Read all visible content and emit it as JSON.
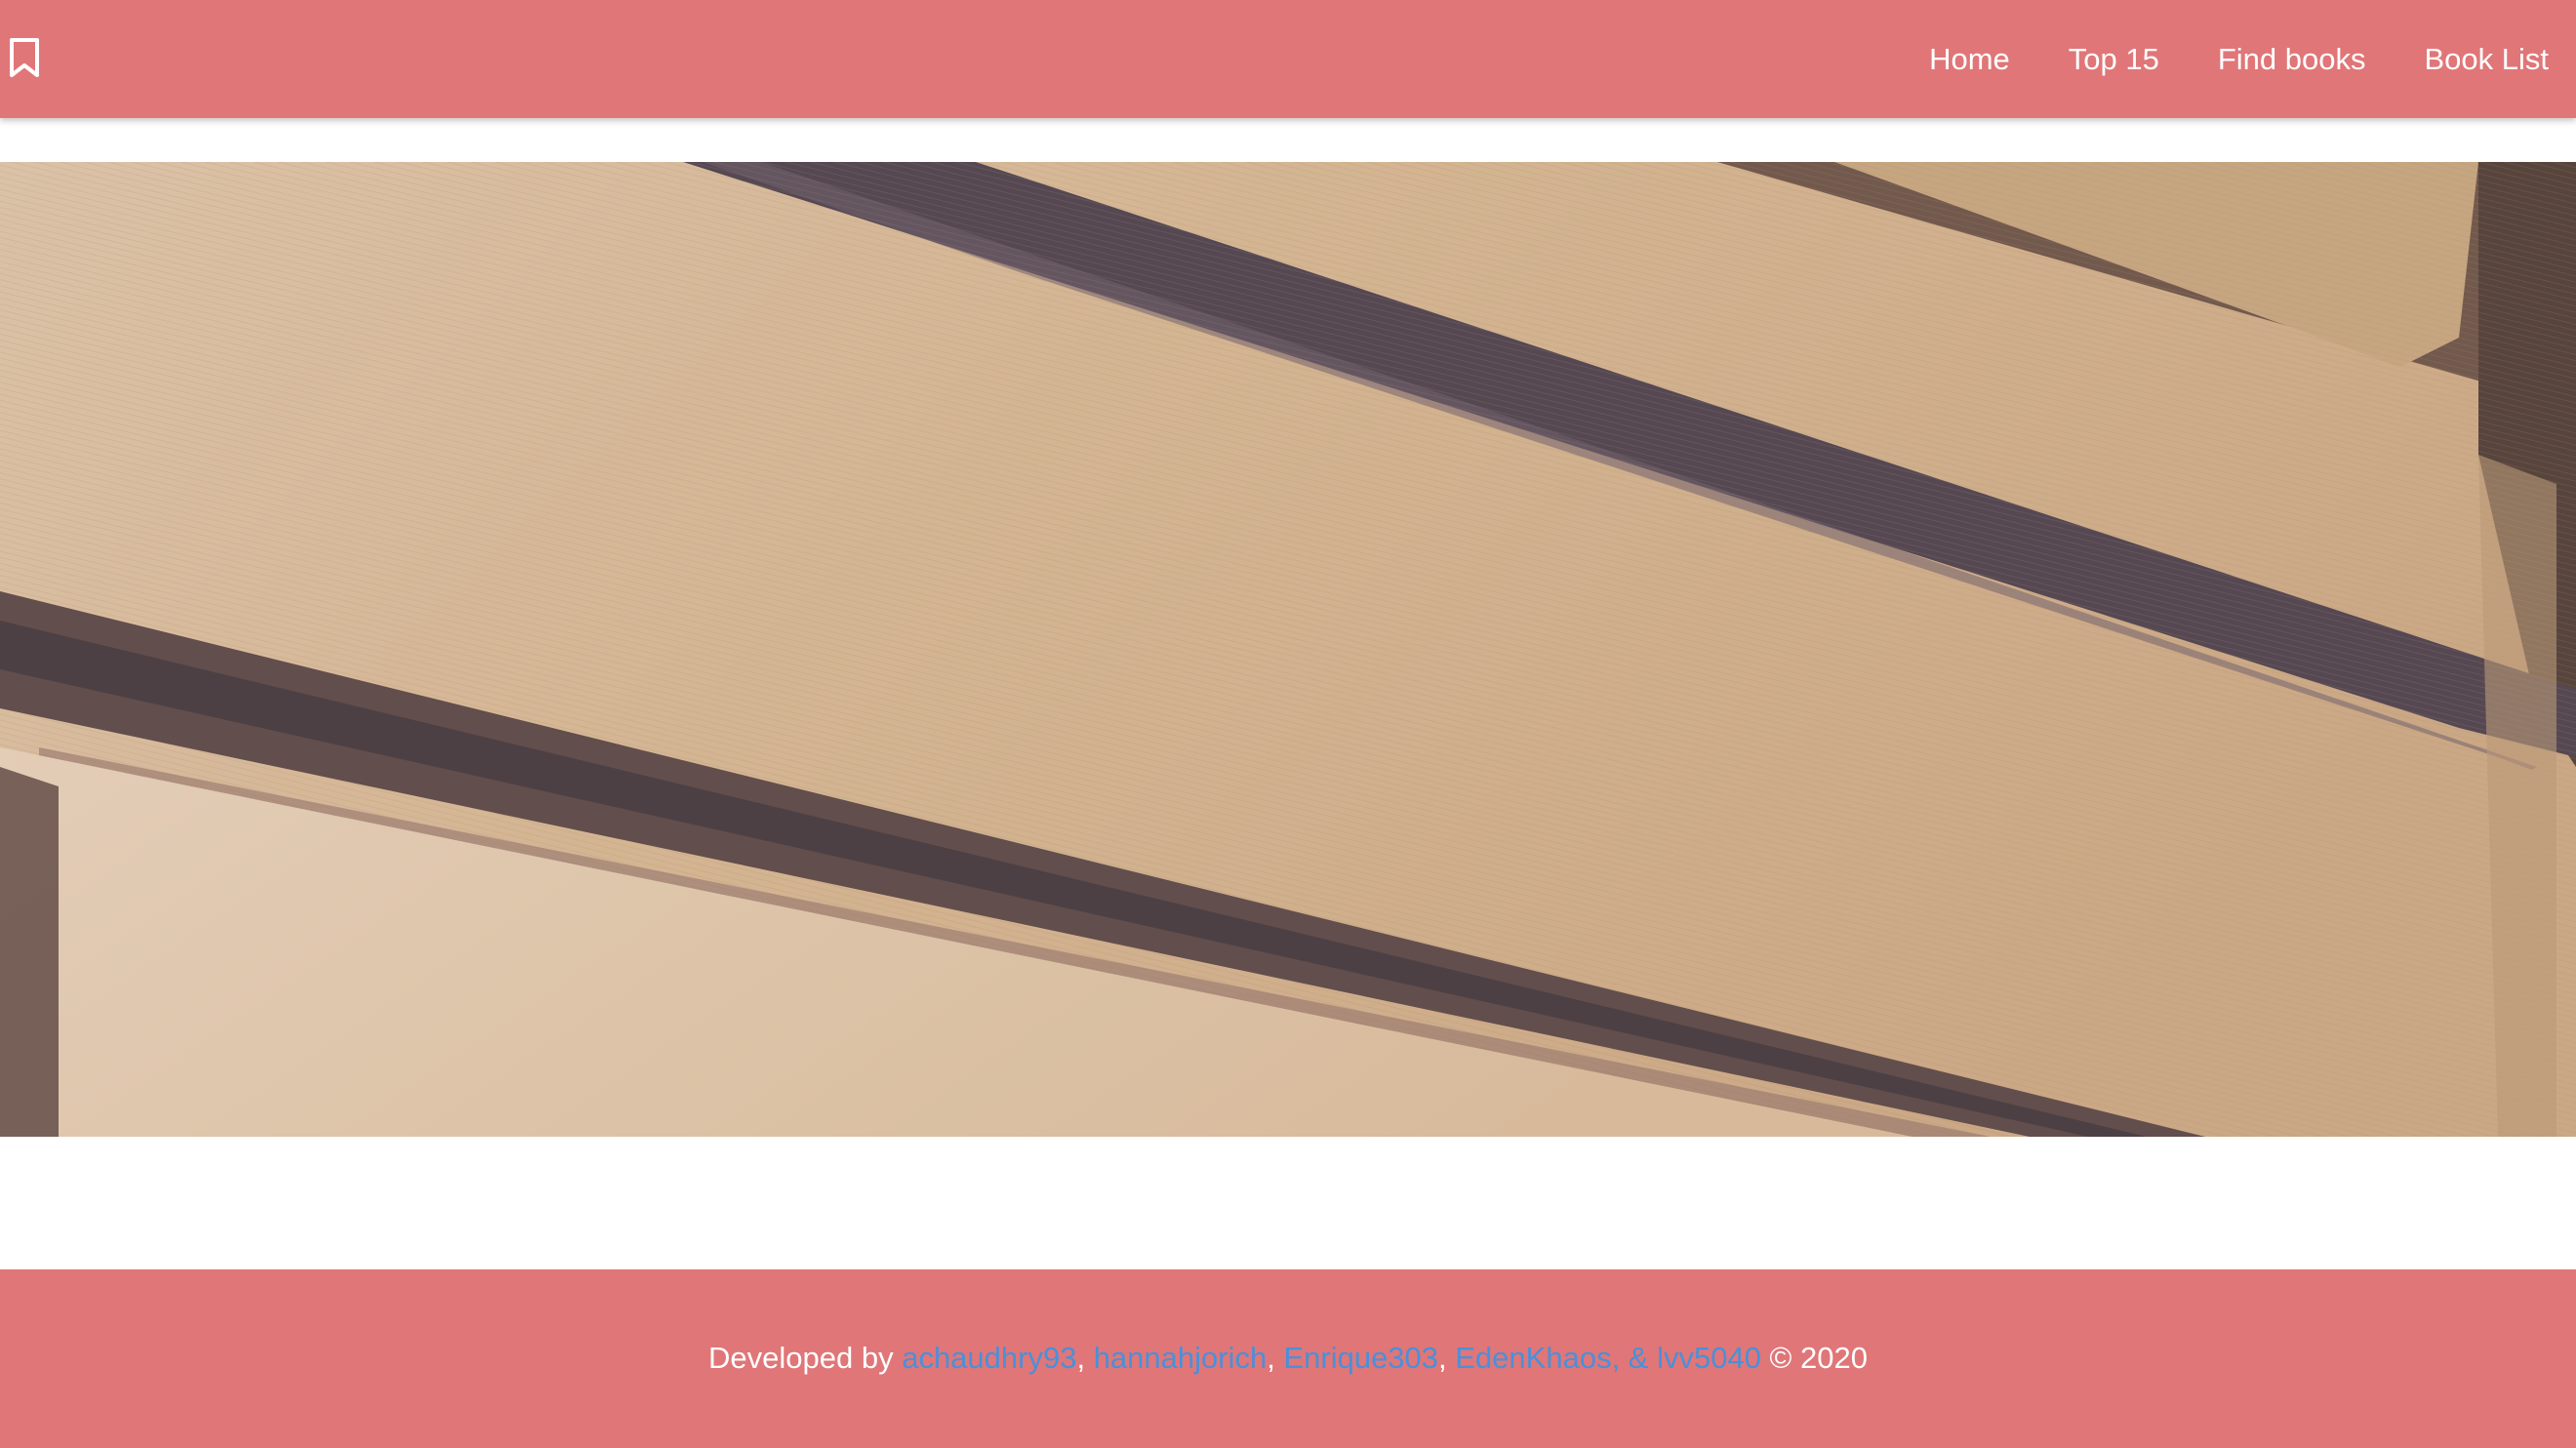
{
  "navbar": {
    "brand_icon": "bookmark-icon",
    "links": [
      {
        "label": "Home"
      },
      {
        "label": "Top 15"
      },
      {
        "label": "Find books"
      },
      {
        "label": "Book List"
      }
    ]
  },
  "hero": {
    "image": "stacked-books-photo"
  },
  "footer": {
    "prefix": "Developed by ",
    "authors": [
      "achaudhry93",
      "hannahjorich",
      "Enrique303",
      "EdenKhaos, & lvv5040"
    ],
    "separator": ", ",
    "suffix": " © 2020"
  },
  "colors": {
    "brand": "#e07678",
    "link": "#4a90d9",
    "text": "#ffffff"
  }
}
